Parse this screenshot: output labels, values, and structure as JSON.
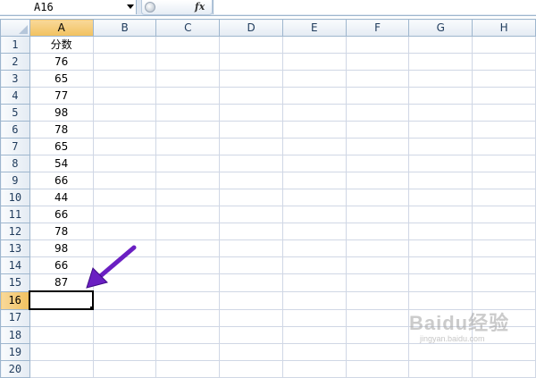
{
  "formula_bar": {
    "name_box": "A16",
    "fx_label": "fx",
    "formula": ""
  },
  "columns": [
    "A",
    "B",
    "C",
    "D",
    "E",
    "F",
    "G",
    "H"
  ],
  "active_column": "A",
  "rows": [
    {
      "n": "1",
      "a": "分数"
    },
    {
      "n": "2",
      "a": "76"
    },
    {
      "n": "3",
      "a": "65"
    },
    {
      "n": "4",
      "a": "77"
    },
    {
      "n": "5",
      "a": "98"
    },
    {
      "n": "6",
      "a": "78"
    },
    {
      "n": "7",
      "a": "65"
    },
    {
      "n": "8",
      "a": "54"
    },
    {
      "n": "9",
      "a": "66"
    },
    {
      "n": "10",
      "a": "44"
    },
    {
      "n": "11",
      "a": "66"
    },
    {
      "n": "12",
      "a": "78"
    },
    {
      "n": "13",
      "a": "98"
    },
    {
      "n": "14",
      "a": "66"
    },
    {
      "n": "15",
      "a": "87"
    },
    {
      "n": "16",
      "a": ""
    },
    {
      "n": "17",
      "a": ""
    },
    {
      "n": "18",
      "a": ""
    },
    {
      "n": "19",
      "a": ""
    },
    {
      "n": "20",
      "a": ""
    }
  ],
  "active_row": "16",
  "annotation": {
    "arrow_color": "#6a1fc2"
  },
  "watermark": {
    "logo": "Baidu经验",
    "url": "jingyan.baidu.com"
  },
  "colors": {
    "header_bg": "#e4ebf3",
    "active_header": "#f1c15f",
    "gridline": "#d0d7e5"
  }
}
